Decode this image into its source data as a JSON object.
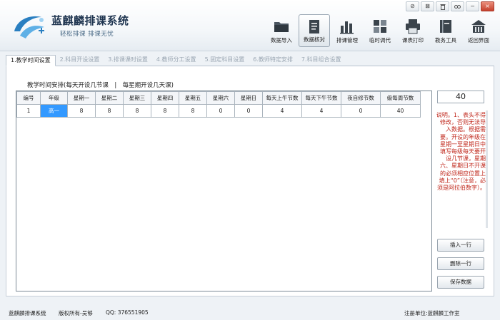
{
  "app": {
    "title": "蓝麒麟排课系统",
    "slogan": "轻松排课  排课无忧"
  },
  "window_controls": [
    "⊘",
    "⊠",
    "🗑",
    "🔗",
    "−",
    "×"
  ],
  "toolbar": [
    {
      "label": "数据导入",
      "icon": "folder-icon"
    },
    {
      "label": "数据核对",
      "icon": "document-icon",
      "active": true
    },
    {
      "label": "排课管理",
      "icon": "bar-chart-icon"
    },
    {
      "label": "临时调代",
      "icon": "exchange-icon"
    },
    {
      "label": "课表打印",
      "icon": "printer-icon"
    },
    {
      "label": "教务工具",
      "icon": "book-icon"
    },
    {
      "label": "返回界面",
      "icon": "home-icon"
    }
  ],
  "tabs": [
    {
      "label": "1.教学时间设置",
      "active": true
    },
    {
      "label": "2.科目开设设置"
    },
    {
      "label": "3.排课课时设置"
    },
    {
      "label": "4.教师分工设置"
    },
    {
      "label": "5.固定科目设置"
    },
    {
      "label": "6.教师特定安排"
    },
    {
      "label": "7.科目组合设置"
    }
  ],
  "main": {
    "section_label": "教学时间安排(每天开设几节课　|　每星期开设几天课)",
    "columns": [
      "编号",
      "年级",
      "星期一",
      "星期二",
      "星期三",
      "星期四",
      "星期五",
      "星期六",
      "星期日",
      "每天上午节数",
      "每天下午节数",
      "夜自修节数",
      "级每周节数"
    ],
    "rows": [
      [
        "1",
        "高一",
        "8",
        "8",
        "8",
        "8",
        "8",
        "0",
        "0",
        "4",
        "4",
        "0",
        "40"
      ]
    ],
    "selected_cell": {
      "row": 0,
      "col": 1
    }
  },
  "side": {
    "total": "40",
    "note": "说明。1、表头不得修改，否则无法导入数据。根据需要。开设的年级在星期一至星期日中填写每级每天要开设几节课，星期六、星期日不开课的必须相应位置上填上“0”（注意，必须是阿拉伯数字）。",
    "insert_button": "插入一行",
    "delete_button": "删除一行",
    "save_button": "保存数据"
  },
  "footer": {
    "app_name": "蓝麒麟排课系统",
    "copyright": "版权所有-吴够",
    "qq": "QQ: 376551905",
    "registrant": "注册单位:蓝麒麟工作室"
  },
  "colors": {
    "accent": "#3399ff",
    "note": "#c0281c",
    "title": "#1f3550"
  }
}
